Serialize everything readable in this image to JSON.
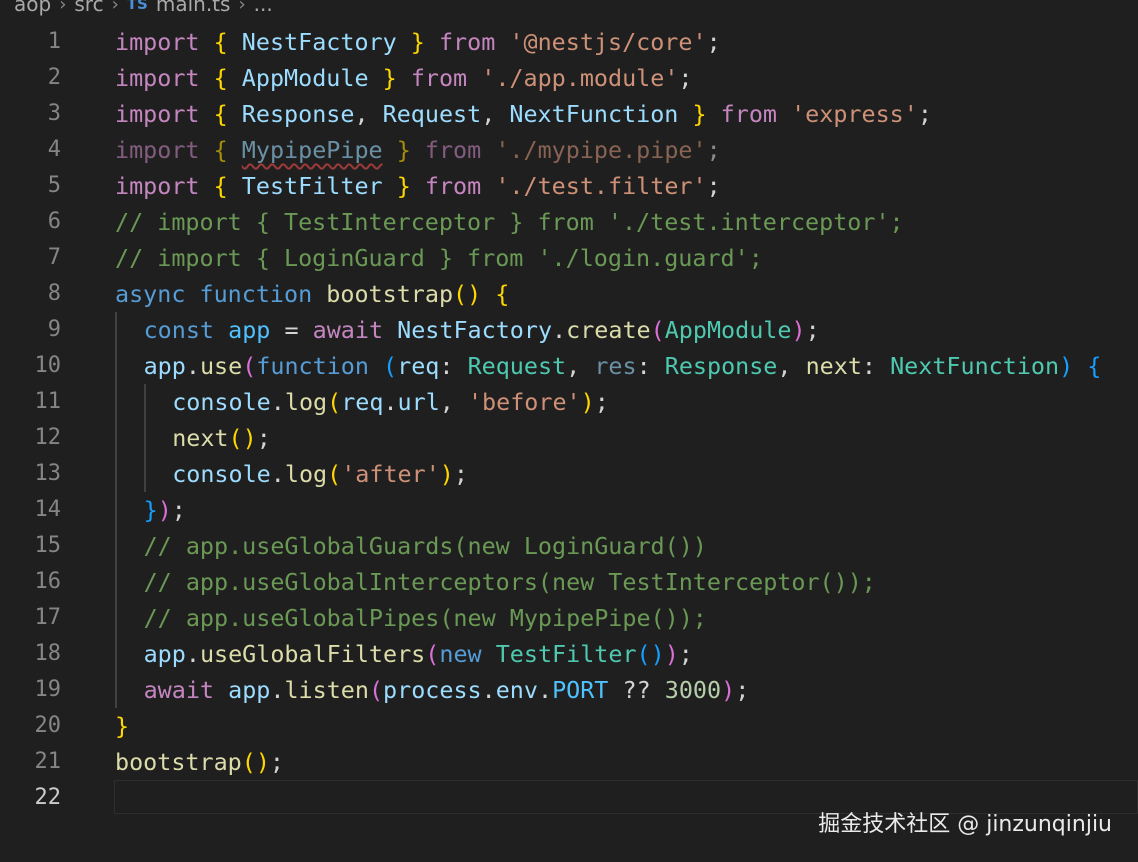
{
  "breadcrumb": {
    "segments": [
      "aop",
      "src"
    ],
    "file_icon": "TS",
    "file_name": "main.ts",
    "ellipsis": "...",
    "separator": "›"
  },
  "editor": {
    "active_line": 22,
    "language": "typescript",
    "lines": [
      {
        "n": "1",
        "indent": 0,
        "dim": false,
        "tokens": [
          {
            "t": "import",
            "c": "kw"
          },
          {
            "t": " ",
            "c": "p"
          },
          {
            "t": "{",
            "c": "b1"
          },
          {
            "t": " ",
            "c": "p"
          },
          {
            "t": "NestFactory",
            "c": "va"
          },
          {
            "t": " ",
            "c": "p"
          },
          {
            "t": "}",
            "c": "b1"
          },
          {
            "t": " ",
            "c": "p"
          },
          {
            "t": "from",
            "c": "kw"
          },
          {
            "t": " ",
            "c": "p"
          },
          {
            "t": "'@nestjs/core'",
            "c": "str"
          },
          {
            "t": ";",
            "c": "p"
          }
        ]
      },
      {
        "n": "2",
        "indent": 0,
        "dim": false,
        "tokens": [
          {
            "t": "import",
            "c": "kw"
          },
          {
            "t": " ",
            "c": "p"
          },
          {
            "t": "{",
            "c": "b1"
          },
          {
            "t": " ",
            "c": "p"
          },
          {
            "t": "AppModule",
            "c": "va"
          },
          {
            "t": " ",
            "c": "p"
          },
          {
            "t": "}",
            "c": "b1"
          },
          {
            "t": " ",
            "c": "p"
          },
          {
            "t": "from",
            "c": "kw"
          },
          {
            "t": " ",
            "c": "p"
          },
          {
            "t": "'./app.module'",
            "c": "str"
          },
          {
            "t": ";",
            "c": "p"
          }
        ]
      },
      {
        "n": "3",
        "indent": 0,
        "dim": false,
        "tokens": [
          {
            "t": "import",
            "c": "kw"
          },
          {
            "t": " ",
            "c": "p"
          },
          {
            "t": "{",
            "c": "b1"
          },
          {
            "t": " ",
            "c": "p"
          },
          {
            "t": "Response",
            "c": "va"
          },
          {
            "t": ", ",
            "c": "p"
          },
          {
            "t": "Request",
            "c": "va"
          },
          {
            "t": ", ",
            "c": "p"
          },
          {
            "t": "NextFunction",
            "c": "va"
          },
          {
            "t": " ",
            "c": "p"
          },
          {
            "t": "}",
            "c": "b1"
          },
          {
            "t": " ",
            "c": "p"
          },
          {
            "t": "from",
            "c": "kw"
          },
          {
            "t": " ",
            "c": "p"
          },
          {
            "t": "'express'",
            "c": "str"
          },
          {
            "t": ";",
            "c": "p"
          }
        ]
      },
      {
        "n": "4",
        "indent": 0,
        "dim": true,
        "tokens": [
          {
            "t": "import",
            "c": "kw"
          },
          {
            "t": " ",
            "c": "p"
          },
          {
            "t": "{",
            "c": "b1"
          },
          {
            "t": " ",
            "c": "p"
          },
          {
            "t": "MypipePipe",
            "c": "va squiggle"
          },
          {
            "t": " ",
            "c": "p"
          },
          {
            "t": "}",
            "c": "b1"
          },
          {
            "t": " ",
            "c": "p"
          },
          {
            "t": "from",
            "c": "kw"
          },
          {
            "t": " ",
            "c": "p"
          },
          {
            "t": "'./mypipe.pipe'",
            "c": "str"
          },
          {
            "t": ";",
            "c": "p"
          }
        ]
      },
      {
        "n": "5",
        "indent": 0,
        "dim": false,
        "tokens": [
          {
            "t": "import",
            "c": "kw"
          },
          {
            "t": " ",
            "c": "p"
          },
          {
            "t": "{",
            "c": "b1"
          },
          {
            "t": " ",
            "c": "p"
          },
          {
            "t": "TestFilter",
            "c": "va"
          },
          {
            "t": " ",
            "c": "p"
          },
          {
            "t": "}",
            "c": "b1"
          },
          {
            "t": " ",
            "c": "p"
          },
          {
            "t": "from",
            "c": "kw"
          },
          {
            "t": " ",
            "c": "p"
          },
          {
            "t": "'./test.filter'",
            "c": "str"
          },
          {
            "t": ";",
            "c": "p"
          }
        ]
      },
      {
        "n": "6",
        "indent": 0,
        "dim": false,
        "tokens": [
          {
            "t": "// import { TestInterceptor } from './test.interceptor';",
            "c": "cm"
          }
        ]
      },
      {
        "n": "7",
        "indent": 0,
        "dim": false,
        "tokens": [
          {
            "t": "// import { LoginGuard } from './login.guard';",
            "c": "cm"
          }
        ]
      },
      {
        "n": "8",
        "indent": 0,
        "dim": false,
        "tokens": [
          {
            "t": "async",
            "c": "st"
          },
          {
            "t": " ",
            "c": "p"
          },
          {
            "t": "function",
            "c": "st"
          },
          {
            "t": " ",
            "c": "p"
          },
          {
            "t": "bootstrap",
            "c": "fn"
          },
          {
            "t": "()",
            "c": "b1"
          },
          {
            "t": " ",
            "c": "p"
          },
          {
            "t": "{",
            "c": "b1"
          }
        ]
      },
      {
        "n": "9",
        "indent": 1,
        "dim": false,
        "tokens": [
          {
            "t": "const",
            "c": "st"
          },
          {
            "t": " ",
            "c": "p"
          },
          {
            "t": "app",
            "c": "vc"
          },
          {
            "t": " = ",
            "c": "p"
          },
          {
            "t": "await",
            "c": "kw"
          },
          {
            "t": " ",
            "c": "p"
          },
          {
            "t": "NestFactory",
            "c": "va"
          },
          {
            "t": ".",
            "c": "p"
          },
          {
            "t": "create",
            "c": "fn"
          },
          {
            "t": "(",
            "c": "b2"
          },
          {
            "t": "AppModule",
            "c": "ty"
          },
          {
            "t": ")",
            "c": "b2"
          },
          {
            "t": ";",
            "c": "p"
          }
        ]
      },
      {
        "n": "10",
        "indent": 1,
        "dim": false,
        "tokens": [
          {
            "t": "app",
            "c": "va"
          },
          {
            "t": ".",
            "c": "p"
          },
          {
            "t": "use",
            "c": "fn"
          },
          {
            "t": "(",
            "c": "b2"
          },
          {
            "t": "function",
            "c": "st"
          },
          {
            "t": " ",
            "c": "p"
          },
          {
            "t": "(",
            "c": "b3"
          },
          {
            "t": "req",
            "c": "va"
          },
          {
            "t": ": ",
            "c": "p"
          },
          {
            "t": "Request",
            "c": "ty"
          },
          {
            "t": ", ",
            "c": "p"
          },
          {
            "t": "res",
            "c": "va dim"
          },
          {
            "t": ": ",
            "c": "p"
          },
          {
            "t": "Response",
            "c": "ty"
          },
          {
            "t": ", ",
            "c": "p"
          },
          {
            "t": "next",
            "c": "fn"
          },
          {
            "t": ": ",
            "c": "p"
          },
          {
            "t": "NextFunction",
            "c": "ty"
          },
          {
            "t": ")",
            "c": "b3"
          },
          {
            "t": " ",
            "c": "p"
          },
          {
            "t": "{",
            "c": "b3"
          }
        ]
      },
      {
        "n": "11",
        "indent": 2,
        "dim": false,
        "tokens": [
          {
            "t": "console",
            "c": "va"
          },
          {
            "t": ".",
            "c": "p"
          },
          {
            "t": "log",
            "c": "fn"
          },
          {
            "t": "(",
            "c": "b1"
          },
          {
            "t": "req",
            "c": "va"
          },
          {
            "t": ".",
            "c": "p"
          },
          {
            "t": "url",
            "c": "va"
          },
          {
            "t": ", ",
            "c": "p"
          },
          {
            "t": "'before'",
            "c": "str"
          },
          {
            "t": ")",
            "c": "b1"
          },
          {
            "t": ";",
            "c": "p"
          }
        ]
      },
      {
        "n": "12",
        "indent": 2,
        "dim": false,
        "tokens": [
          {
            "t": "next",
            "c": "fn"
          },
          {
            "t": "()",
            "c": "b1"
          },
          {
            "t": ";",
            "c": "p"
          }
        ]
      },
      {
        "n": "13",
        "indent": 2,
        "dim": false,
        "tokens": [
          {
            "t": "console",
            "c": "va"
          },
          {
            "t": ".",
            "c": "p"
          },
          {
            "t": "log",
            "c": "fn"
          },
          {
            "t": "(",
            "c": "b1"
          },
          {
            "t": "'after'",
            "c": "str"
          },
          {
            "t": ")",
            "c": "b1"
          },
          {
            "t": ";",
            "c": "p"
          }
        ]
      },
      {
        "n": "14",
        "indent": 1,
        "dim": false,
        "tokens": [
          {
            "t": "}",
            "c": "b3"
          },
          {
            "t": ")",
            "c": "b2"
          },
          {
            "t": ";",
            "c": "p"
          }
        ]
      },
      {
        "n": "15",
        "indent": 1,
        "dim": false,
        "tokens": [
          {
            "t": "// app.useGlobalGuards(new LoginGuard())",
            "c": "cm"
          }
        ]
      },
      {
        "n": "16",
        "indent": 1,
        "dim": false,
        "tokens": [
          {
            "t": "// app.useGlobalInterceptors(new TestInterceptor());",
            "c": "cm"
          }
        ]
      },
      {
        "n": "17",
        "indent": 1,
        "dim": false,
        "tokens": [
          {
            "t": "// app.useGlobalPipes(new MypipePipe());",
            "c": "cm"
          }
        ]
      },
      {
        "n": "18",
        "indent": 1,
        "dim": false,
        "tokens": [
          {
            "t": "app",
            "c": "va"
          },
          {
            "t": ".",
            "c": "p"
          },
          {
            "t": "useGlobalFilters",
            "c": "fn"
          },
          {
            "t": "(",
            "c": "b2"
          },
          {
            "t": "new",
            "c": "st"
          },
          {
            "t": " ",
            "c": "p"
          },
          {
            "t": "TestFilter",
            "c": "ty"
          },
          {
            "t": "()",
            "c": "b3"
          },
          {
            "t": ")",
            "c": "b2"
          },
          {
            "t": ";",
            "c": "p"
          }
        ]
      },
      {
        "n": "19",
        "indent": 1,
        "dim": false,
        "tokens": [
          {
            "t": "await",
            "c": "kw"
          },
          {
            "t": " ",
            "c": "p"
          },
          {
            "t": "app",
            "c": "va"
          },
          {
            "t": ".",
            "c": "p"
          },
          {
            "t": "listen",
            "c": "fn"
          },
          {
            "t": "(",
            "c": "b2"
          },
          {
            "t": "process",
            "c": "va"
          },
          {
            "t": ".",
            "c": "p"
          },
          {
            "t": "env",
            "c": "va"
          },
          {
            "t": ".",
            "c": "p"
          },
          {
            "t": "PORT",
            "c": "vc"
          },
          {
            "t": " ?? ",
            "c": "p"
          },
          {
            "t": "3000",
            "c": "num"
          },
          {
            "t": ")",
            "c": "b2"
          },
          {
            "t": ";",
            "c": "p"
          }
        ]
      },
      {
        "n": "20",
        "indent": 0,
        "dim": false,
        "tokens": [
          {
            "t": "}",
            "c": "b1"
          }
        ]
      },
      {
        "n": "21",
        "indent": 0,
        "dim": false,
        "tokens": [
          {
            "t": "bootstrap",
            "c": "fn"
          },
          {
            "t": "()",
            "c": "b1"
          },
          {
            "t": ";",
            "c": "p"
          }
        ]
      },
      {
        "n": "22",
        "indent": 0,
        "dim": false,
        "tokens": []
      }
    ]
  },
  "watermark": "掘金技术社区 @ jinzunqinjiu",
  "colors": {
    "background": "#1f1f1f",
    "keyword_control": "#c586c0",
    "keyword_storage": "#569cd6",
    "function": "#dcdcaa",
    "type": "#4ec9b0",
    "variable": "#9cdcfe",
    "string": "#ce9178",
    "number": "#b5cea8",
    "comment": "#6a9955"
  }
}
